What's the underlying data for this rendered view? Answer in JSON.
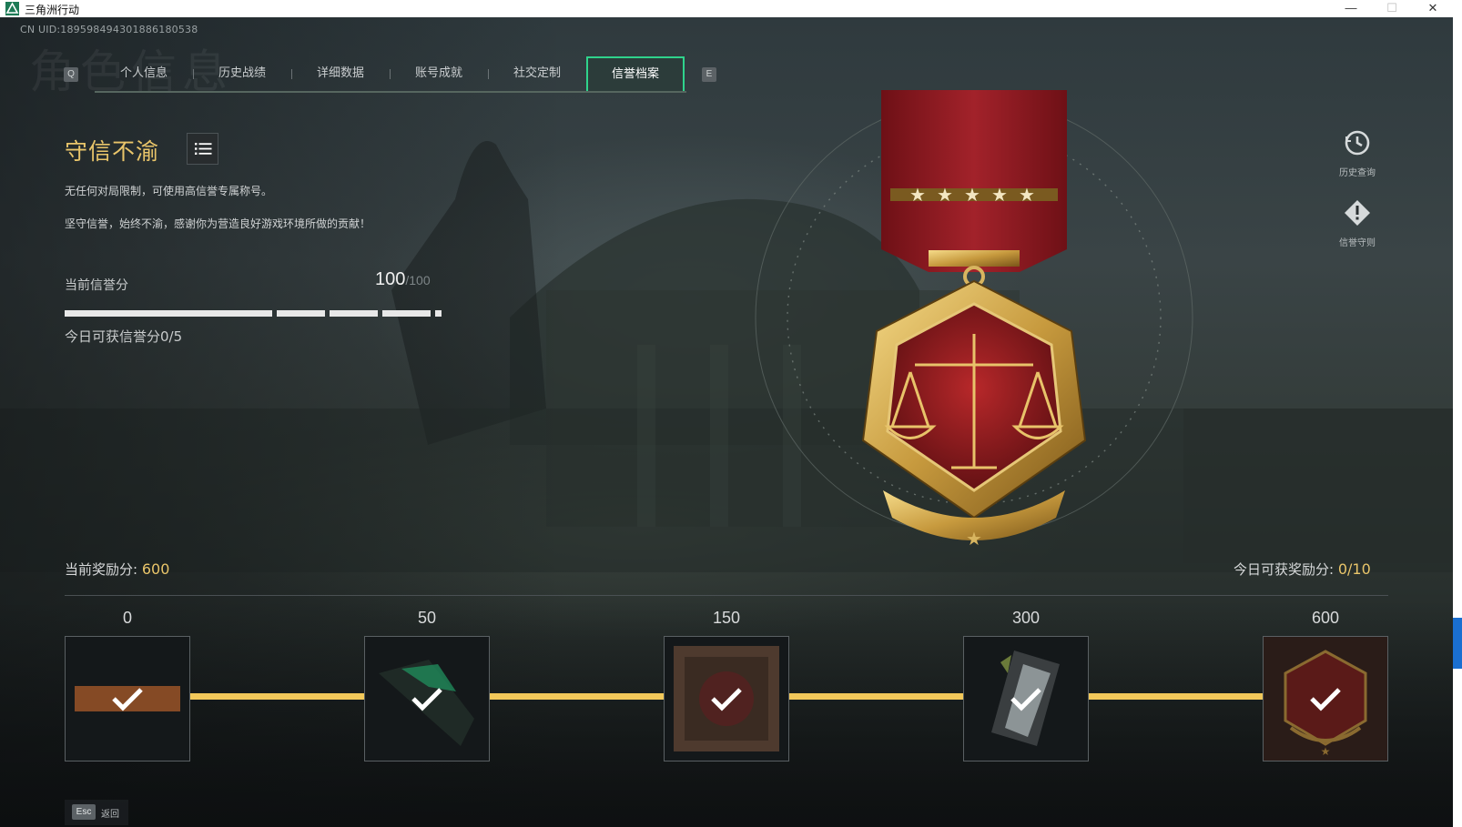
{
  "window": {
    "title": "三角洲行动",
    "minimize": "—",
    "maximize": "☐",
    "close": "✕"
  },
  "header": {
    "uid": "CN UID:1895984943018861805​38",
    "watermark": "角色信息"
  },
  "tabs": {
    "prev_key": "Q",
    "next_key": "E",
    "items": [
      {
        "label": "个人信息"
      },
      {
        "label": "历史战绩"
      },
      {
        "label": "详细数据"
      },
      {
        "label": "账号成就"
      },
      {
        "label": "社交定制"
      },
      {
        "label": "信誉档案",
        "active": true
      }
    ]
  },
  "honor": {
    "title": "守信不渝",
    "desc1": "无任何对局限制，可使用高信誉专属称号。",
    "desc2": "坚守信誉，始终不渝，感谢你为营造良好游戏环境所做的贡献！",
    "score_label": "当前信誉分",
    "score": "100",
    "score_max": "/100",
    "today_label": "今日可获信誉分0/5"
  },
  "side": {
    "history_label": "历史查询",
    "rules_label": "信誉守则"
  },
  "rewards": {
    "current_label": "当前奖励分: ",
    "current_value": "600",
    "today_label": "今日可获奖励分: ",
    "today_value": "0/10",
    "milestones": [
      {
        "score": "0",
        "claimed": true
      },
      {
        "score": "50",
        "claimed": true
      },
      {
        "score": "150",
        "claimed": true
      },
      {
        "score": "300",
        "claimed": true
      },
      {
        "score": "600",
        "claimed": true
      }
    ]
  },
  "footer": {
    "esc_key": "Esc",
    "esc_label": "返回"
  },
  "colors": {
    "accent_gold": "#e9c56a",
    "track_gold": "#f2c85a",
    "active_tab": "#2fd38c"
  }
}
